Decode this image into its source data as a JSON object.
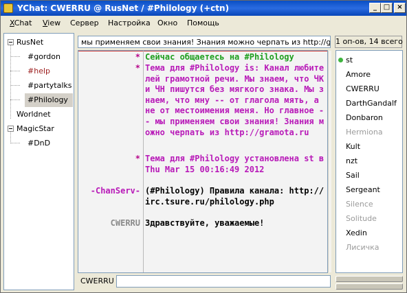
{
  "window": {
    "title": "YChat: CWERRU @ RusNet / #Philology (+ctn)"
  },
  "menu": [
    {
      "label": "XChat"
    },
    {
      "label": "View"
    },
    {
      "label": "Сервер"
    },
    {
      "label": "Настройка"
    },
    {
      "label": "Окно"
    },
    {
      "label": "Помощь"
    }
  ],
  "tree": {
    "servers": [
      {
        "name": "RusNet",
        "channels": [
          {
            "name": "#gordon",
            "color": "#000000"
          },
          {
            "name": "#help",
            "color": "#9b1c1c"
          },
          {
            "name": "#partytalks",
            "color": "#000000"
          },
          {
            "name": "#Philology",
            "color": "#000000",
            "selected": true
          }
        ]
      },
      {
        "name": "Worldnet",
        "channels": []
      },
      {
        "name": "MagicStar",
        "channels": [
          {
            "name": "#DnD",
            "color": "#000000"
          }
        ]
      }
    ]
  },
  "topic_bar": {
    "text": "мы применяем свои знания! Знания можно черпать из http://gramota.ru",
    "user_count": "1 оп-ов, 14 всего"
  },
  "chat": {
    "lines": [
      {
        "nick": "*",
        "nick_color": "#b7088a",
        "text": "Сейчас общаетесь на #Philology",
        "color": "#1e9e1e"
      },
      {
        "nick": "*",
        "nick_color": "#b7088a",
        "text": "Тема для #Philology is: Канал любителей грамотной речи. Мы знаем, что ЧК и ЧН пишутся без мягкого знака. Мы знаем, что мну -- от глагола мять, а не от местоимения меня. Но главное -- мы применяем свои знания! Знания можно черпать из http://gramota.ru",
        "color": "#b81ab8"
      },
      {
        "nick": "*",
        "nick_color": "#b7088a",
        "text": "Тема для #Philology установлена st в Thu Mar 15 00:16:49 2012",
        "color": "#b81ab8"
      },
      {
        "nick": "-ChanServ-",
        "nick_color": "#b81ab8",
        "text": "(#Philology) Правила канала: http://irc.tsure.ru/philology.php",
        "color": "#000000"
      },
      {
        "nick": "CWERRU",
        "nick_color": "#8a8a8a",
        "text": "Здравствуйте, уважаемые!",
        "color": "#000000"
      }
    ]
  },
  "input": {
    "nick": "CWERRU",
    "value": ""
  },
  "users": [
    {
      "name": "st",
      "op": true,
      "color": "#000000"
    },
    {
      "name": "Amore",
      "color": "#000000"
    },
    {
      "name": "CWERRU",
      "color": "#000000"
    },
    {
      "name": "DarthGandalf",
      "color": "#000000"
    },
    {
      "name": "Donbaron",
      "color": "#000000"
    },
    {
      "name": "Hermiona",
      "color": "#9a9a9a"
    },
    {
      "name": "Kult",
      "color": "#000000"
    },
    {
      "name": "nzt",
      "color": "#000000"
    },
    {
      "name": "Sail",
      "color": "#000000"
    },
    {
      "name": "Sergeant",
      "color": "#000000"
    },
    {
      "name": "Silence",
      "color": "#9a9a9a"
    },
    {
      "name": "Solitude",
      "color": "#9a9a9a"
    },
    {
      "name": "Xedin",
      "color": "#000000"
    },
    {
      "name": "Лисичка",
      "color": "#9a9a9a"
    }
  ]
}
